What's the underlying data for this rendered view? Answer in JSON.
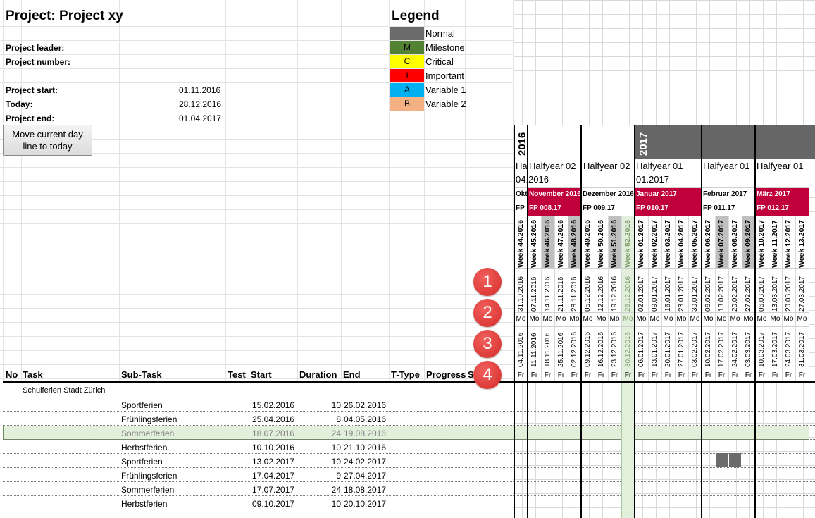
{
  "project": {
    "title": "Project: Project xy",
    "leader_label": "Project leader:",
    "number_label": "Project number:",
    "start_label": "Project start:",
    "start_value": "01.11.2016",
    "today_label": "Today:",
    "today_value": "28.12.2016",
    "end_label": "Project end:",
    "end_value": "01.04.2017",
    "move_button": "Move current day line to today"
  },
  "legend": {
    "title": "Legend",
    "items": [
      {
        "code": "",
        "label": "Normal",
        "color": "#6b6b6b"
      },
      {
        "code": "M",
        "label": "Milestone",
        "color": "#548235"
      },
      {
        "code": "C",
        "label": "Critical",
        "color": "#ffff00"
      },
      {
        "code": "I",
        "label": "Important",
        "color": "#ff0000"
      },
      {
        "code": "A",
        "label": "Variable 1",
        "color": "#00b0f0"
      },
      {
        "code": "B",
        "label": "Variable 2",
        "color": "#f4b183"
      }
    ]
  },
  "table": {
    "headers": [
      "No",
      "Task",
      "Sub-Task",
      "Test",
      "Start",
      "Duration",
      "End",
      "T-Type",
      "Progress",
      "S"
    ],
    "group": "Schulferien Stadt Zürich",
    "rows": [
      {
        "subtask": "Sportferien",
        "start": "15.02.2016",
        "duration": "10",
        "end": "26.02.2016"
      },
      {
        "subtask": "Frühlingsferien",
        "start": "25.04.2016",
        "duration": "8",
        "end": "04.05.2016"
      },
      {
        "subtask": "Sommerferien",
        "start": "18.07.2016",
        "duration": "24",
        "end": "19.08.2016"
      },
      {
        "subtask": "Herbstferien",
        "start": "10.10.2016",
        "duration": "10",
        "end": "21.10.2016"
      },
      {
        "subtask": "Sportferien",
        "start": "13.02.2017",
        "duration": "10",
        "end": "24.02.2017"
      },
      {
        "subtask": "Frühlingsferien",
        "start": "17.04.2017",
        "duration": "9",
        "end": "27.04.2017"
      },
      {
        "subtask": "Sommerferien",
        "start": "17.07.2017",
        "duration": "24",
        "end": "18.08.2017"
      },
      {
        "subtask": "Herbstferien",
        "start": "09.10.2017",
        "duration": "10",
        "end": "20.10.2017"
      }
    ]
  },
  "gantt": {
    "year_2016": "2016",
    "year_2017": "2017",
    "halfyears": [
      "Ha",
      "Halfyear 02",
      "Halfyear 02",
      "Halfyear 01",
      "Halfyear 01",
      "Halfyear 01"
    ],
    "halfyear_dates": [
      "04.2016",
      "01.2017"
    ],
    "months": [
      "Okt",
      "November 2016",
      "Dezember 2016",
      "Januar 2017",
      "Februar 2017",
      "März 2017"
    ],
    "fp": [
      "FP",
      "FP 008.17",
      "FP 009.17",
      "FP 010.17",
      "FP 011.17",
      "FP 012.17"
    ],
    "weeks": [
      "Week 44.2016",
      "Week 45.2016",
      "Week 46.2016",
      "Week 47.2016",
      "Week 48.2016",
      "Week 49.2016",
      "Week 50.2016",
      "Week 51.2016",
      "Week 52.2016",
      "Week 01.2017",
      "Week 02.2017",
      "Week 03.2017",
      "Week 04.2017",
      "Week 05.2017",
      "Week 06.2017",
      "Week 07.2017",
      "Week 08.2017",
      "Week 09.2017",
      "Week 10.2017",
      "Week 11.2017",
      "Week 12.2017",
      "Week 13.2017"
    ],
    "mondays": [
      "31.10.2016",
      "07.11.2016",
      "14.11.2016",
      "21.11.2016",
      "28.11.2016",
      "05.12.2016",
      "12.12.2016",
      "19.12.2016",
      "26.12.2016",
      "02.01.2017",
      "09.01.2017",
      "16.01.2017",
      "23.01.2017",
      "30.01.2017",
      "06.02.2017",
      "13.02.2017",
      "20.02.2017",
      "27.02.2017",
      "06.03.2017",
      "13.03.2017",
      "20.03.2017",
      "27.03.2017"
    ],
    "fridays": [
      "04.11.2016",
      "11.11.2016",
      "18.11.2016",
      "25.11.2016",
      "02.12.2016",
      "09.12.2016",
      "16.12.2016",
      "23.12.2016",
      "30.12.2016",
      "06.01.2017",
      "13.01.2017",
      "20.01.2017",
      "27.01.2017",
      "03.02.2017",
      "10.02.2017",
      "17.02.2017",
      "24.02.2017",
      "03.03.2017",
      "10.03.2017",
      "17.03.2017",
      "24.03.2017",
      "31.03.2017"
    ],
    "mo_label": "Mo",
    "fr_label": "Fr"
  },
  "badges": [
    "1",
    "2",
    "3",
    "4"
  ]
}
